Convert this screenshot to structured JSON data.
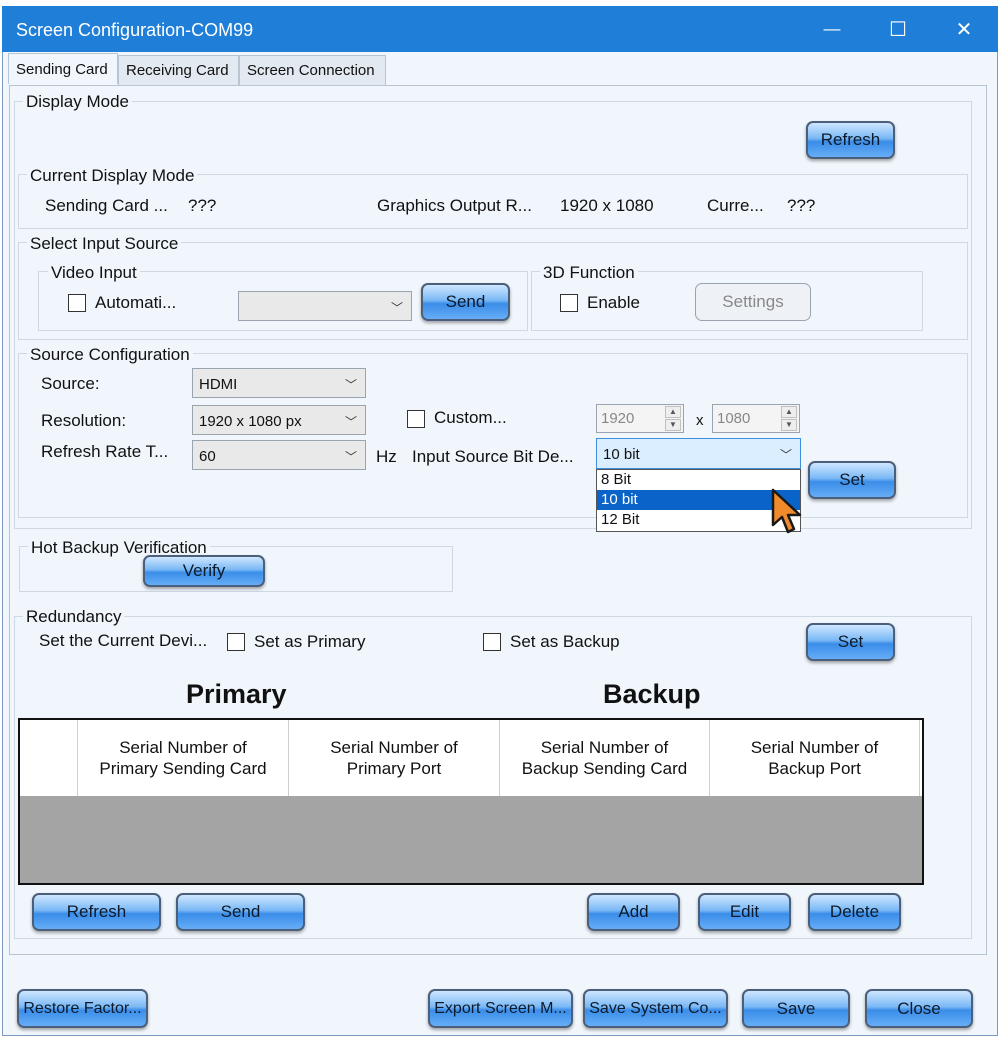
{
  "window": {
    "title": "Screen Configuration-COM99",
    "minimize_glyph": "—",
    "maximize_glyph": "☐",
    "close_glyph": "✕"
  },
  "tabs": [
    "Sending Card",
    "Receiving Card",
    "Screen Connection"
  ],
  "display_mode": {
    "label": "Display Mode",
    "refresh_label": "Refresh",
    "current": {
      "label": "Current Display Mode",
      "sending_card_label": "Sending Card ...",
      "sending_card_value": "???",
      "graphics_label": "Graphics Output R...",
      "graphics_value": "1920 x 1080",
      "curr_label": "Curre...",
      "curr_value": "???"
    },
    "input_source": {
      "label": "Select Input Source",
      "video_input": {
        "label": "Video Input",
        "auto_label": "Automati...",
        "auto_checked": false,
        "select_value": "",
        "send_label": "Send"
      },
      "function_3d": {
        "label": "3D Function",
        "enable_label": "Enable",
        "enable_checked": false,
        "settings_label": "Settings"
      }
    },
    "source_config": {
      "label": "Source Configuration",
      "source_label": "Source:",
      "source_value": "HDMI",
      "resolution_label": "Resolution:",
      "resolution_value": "1920 x 1080 px",
      "custom_label": "Custom...",
      "custom_checked": false,
      "width_value": "1920",
      "x_label": "x",
      "height_value": "1080",
      "refresh_label": "Refresh Rate T...",
      "refresh_value": "60",
      "hz_label": "Hz",
      "bit_depth_label": "Input Source Bit De...",
      "bit_depth_value": "10 bit",
      "bit_depth_options": [
        "8 Bit",
        "10 bit",
        "12 Bit"
      ],
      "bit_depth_highlighted": "10 bit",
      "set_label": "Set"
    }
  },
  "hot_backup": {
    "label": "Hot Backup Verification",
    "verify_label": "Verify"
  },
  "redundancy": {
    "label": "Redundancy",
    "set_current_label": "Set the Current Devi...",
    "primary_label": "Set as Primary",
    "primary_checked": false,
    "backup_label": "Set as Backup",
    "backup_checked": false,
    "set_label": "Set",
    "primary_heading": "Primary",
    "backup_heading": "Backup",
    "columns": [
      "",
      "Serial Number of Primary Sending Card",
      "Serial Number of Primary Port",
      "Serial Number of Backup Sending Card",
      "Serial Number of Backup Port"
    ],
    "rows": [],
    "refresh_label": "Refresh",
    "send_label": "Send",
    "add_label": "Add",
    "edit_label": "Edit",
    "delete_label": "Delete"
  },
  "footer": {
    "restore_label": "Restore Factor...",
    "export_label": "Export Screen M...",
    "save_system_label": "Save System Co...",
    "save_label": "Save",
    "close_label": "Close"
  }
}
